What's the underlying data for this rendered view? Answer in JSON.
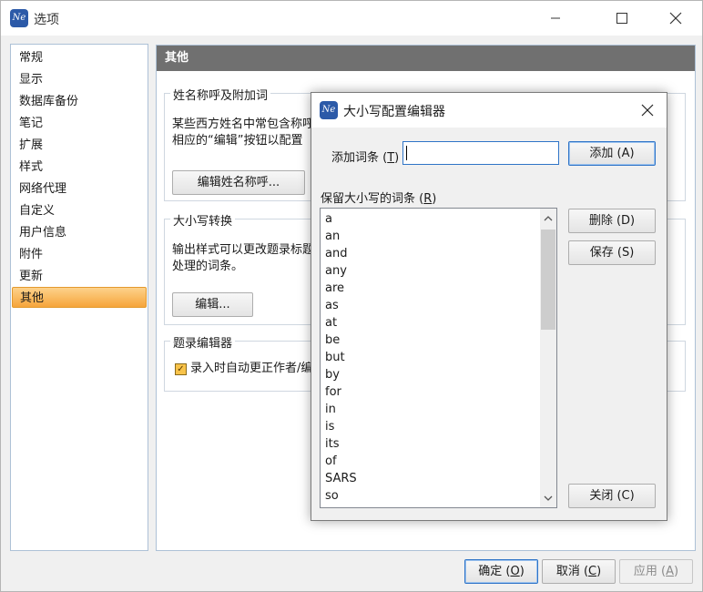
{
  "window": {
    "title": "选项",
    "logo_text": "Ne"
  },
  "nav": {
    "items": [
      "常规",
      "显示",
      "数据库备份",
      "笔记",
      "扩展",
      "样式",
      "网络代理",
      "自定义",
      "用户信息",
      "附件",
      "更新",
      "其他"
    ],
    "selected": "其他"
  },
  "panel": {
    "header": "其他",
    "name_group": {
      "title": "姓名称呼及附加词",
      "line1": "某些西方姓名中常包含称呼",
      "line2": "相应的“编辑”按钮以配置",
      "button": "编辑姓名称呼..."
    },
    "case_group": {
      "title": "大小写转换",
      "line1": "输出样式可以更改题录标题",
      "line2": "处理的词条。",
      "button": "编辑..."
    },
    "editor_group": {
      "title": "题录编辑器",
      "checkbox_label": "录入时自动更正作者/编",
      "checked": true
    }
  },
  "footer": {
    "ok": {
      "text": "确定 (",
      "key": "O",
      "end": ")"
    },
    "cancel": {
      "text": "取消 (",
      "key": "C",
      "end": ")"
    },
    "apply": {
      "text": "应用 (",
      "key": "A",
      "end": ")"
    }
  },
  "dialog": {
    "title": "大小写配置编辑器",
    "logo_text": "Ne",
    "add_label": {
      "text": "添加词条 (",
      "key": "T",
      "end": ")"
    },
    "add_value": "",
    "list_label": {
      "text": "保留大小写的词条 (",
      "key": "R",
      "end": ")"
    },
    "words": [
      "a",
      "an",
      "and",
      "any",
      "are",
      "as",
      "at",
      "be",
      "but",
      "by",
      "for",
      "in",
      "is",
      "its",
      "of",
      "SARS",
      "so"
    ],
    "add_button": "添加 (A)",
    "delete_button": "删除 (D)",
    "save_button": "保存 (S)",
    "close_button": "关闭 (C)"
  }
}
